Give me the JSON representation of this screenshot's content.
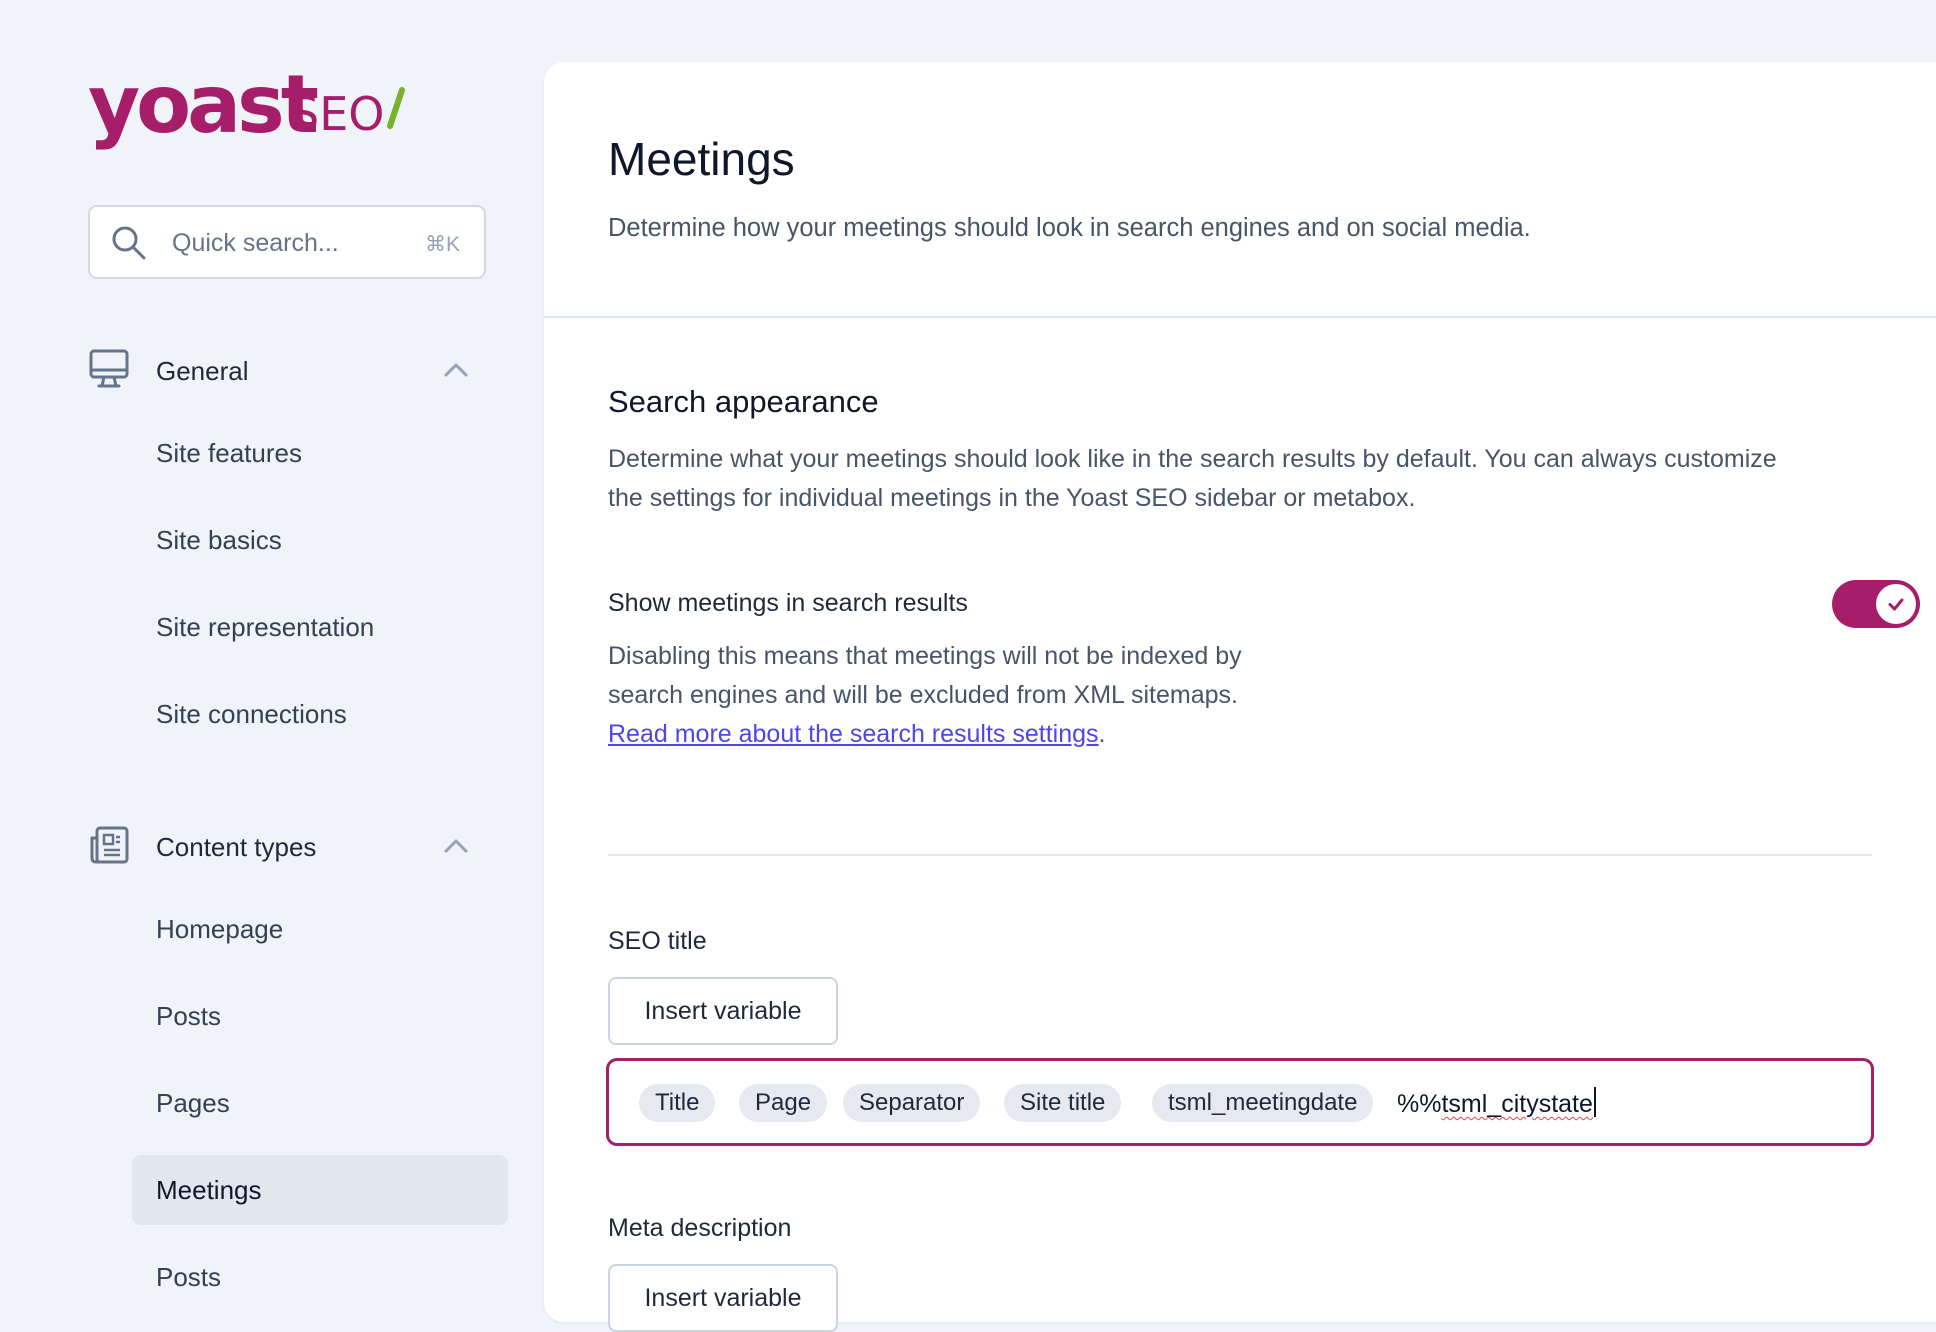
{
  "brand": {
    "logo_text": "yoast",
    "logo_suffix": "SEO",
    "colors": {
      "primary": "#a61e69",
      "slash": "#77b227"
    }
  },
  "search": {
    "placeholder": "Quick search...",
    "shortcut": "⌘K",
    "icon": "search-icon"
  },
  "sidebar": {
    "groups": [
      {
        "label": "General",
        "icon": "desktop-icon",
        "expanded": true,
        "items": [
          "Site features",
          "Site basics",
          "Site representation",
          "Site connections"
        ]
      },
      {
        "label": "Content types",
        "icon": "newspaper-icon",
        "expanded": true,
        "items": [
          "Homepage",
          "Posts",
          "Pages",
          "Meetings",
          "Posts"
        ],
        "active_item": "Meetings"
      }
    ]
  },
  "main": {
    "title": "Meetings",
    "subtitle": "Determine how your meetings should look in search engines and on social media.",
    "search_appearance": {
      "title": "Search appearance",
      "description": "Determine what your meetings should look like in the search results by default. You can always customize the settings for individual meetings in the Yoast SEO sidebar or metabox.",
      "toggle": {
        "label": "Show meetings in search results",
        "description_pre": "Disabling this means that meetings will not be indexed by search engines and will be excluded from XML sitemaps. ",
        "link_text": "Read more about the search results settings",
        "description_post": ".",
        "checked": true
      }
    },
    "seo_title": {
      "label": "SEO title",
      "insert_button": "Insert variable",
      "chips": [
        "Title",
        "Page",
        "Separator",
        "Site title",
        "tsml_meetingdate"
      ],
      "typed_prefix": "%%",
      "typed_text": "tsml_citystate"
    },
    "meta_description": {
      "label": "Meta description",
      "insert_button": "Insert variable"
    }
  }
}
